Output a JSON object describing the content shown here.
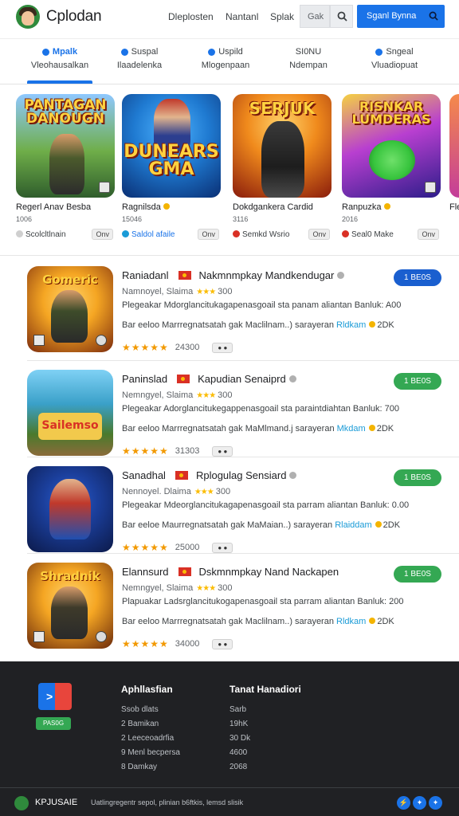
{
  "header": {
    "brand": "Cplodan",
    "nav": [
      "Dleplosten",
      "Nantanl",
      "Splak"
    ],
    "search_value": "Gak",
    "signin_label": "Sganl Bynna"
  },
  "tabs": [
    {
      "top": "Mpalk",
      "bottom": "Vleohausalkan",
      "active": true
    },
    {
      "top": "Suspal",
      "bottom": "Ilaadelenka",
      "active": false
    },
    {
      "top": "Uspild",
      "bottom": "Mlogenpaan",
      "active": false
    },
    {
      "top": "SI0NU",
      "bottom": "Ndempan",
      "active": false
    },
    {
      "top": "Sngeal",
      "bottom": "Vluadiopuat",
      "active": false
    }
  ],
  "featured": [
    {
      "art": "PANTAGAN DANOUGN",
      "name": "Regerl Anav Besba",
      "meta": "1006",
      "footer": "Scolcltlnain",
      "pill": "Onv",
      "colors": {
        "bg1": "#6fae49",
        "bg2": "#2f5d2c",
        "accent": "#c0392b"
      }
    },
    {
      "art": "DUNEARS GMA",
      "name": "Ragnilsda",
      "meta": "15046",
      "footer": "Saldol afaile",
      "pill": "Onv",
      "colors": {
        "bg1": "#1f7ad1",
        "bg2": "#0a2f74",
        "accent": "#e74c3c"
      }
    },
    {
      "art": "SERJUK",
      "name": "Dokdgankera Cardid",
      "meta": "3116",
      "footer": "Semkd Wsrio",
      "pill": "Onv",
      "colors": {
        "bg1": "#f08a1c",
        "bg2": "#8a1c0c",
        "accent": "#2d2d2d"
      }
    },
    {
      "art": "RISNKAR LUMDERAS",
      "name": "Ranpuzka",
      "meta": "2016",
      "footer": "Seal0 Make",
      "pill": "Onv",
      "colors": {
        "bg1": "#b83fd0",
        "bg2": "#2d1d8a",
        "accent": "#37c43d"
      }
    }
  ],
  "featured_partial": {
    "name": "Fle",
    "footer": ""
  },
  "list": [
    {
      "art": "Gomeric",
      "title_a": "Raniadanl",
      "title_b": "Nakmnmpkay Mandkendugar",
      "sub_a": "Namnoyel, Slaima",
      "sub_b": "300",
      "desc": "Plegeakar Mdorglancitukagapenasgoail sta panam aliantan Banluk: A00",
      "dev": "Bar eeloo Marrregnatsatah gak Maclilnam..) sarayeran",
      "dev_hl": "Rldkam",
      "dev_count": "2DK",
      "rating_text": "24300",
      "stars": "★★★★★",
      "install_label": "1 BE0S",
      "install_color": "#1a5fcf",
      "colors": {
        "bg1": "#f5a623",
        "bg2": "#7c2b0d"
      }
    },
    {
      "art": "Sailemso",
      "title_a": "Paninslad",
      "title_b": "Kapudian Senaiprd",
      "sub_a": "Nemngyel, Slaima",
      "sub_b": "300",
      "desc": "Plegeakar Adorglancitukegappenasgoail sta paraintdiahtan Banluk: 700",
      "dev": "Bar eeloo Marrregnatsatah gak MaMlmand.j sarayeran",
      "dev_hl": "Mkdam",
      "dev_count": "2DK",
      "rating_text": "31303",
      "stars": "★★★★★",
      "install_label": "1 BE0S",
      "install_color": "#34a853",
      "colors": {
        "bg1": "#3aa0c8",
        "bg2": "#4a7a2c"
      }
    },
    {
      "art": "",
      "title_a": "Sanadhal",
      "title_b": "Rplogulag Sensiard",
      "sub_a": "Nennoyel. Dlaima",
      "sub_b": "300",
      "desc": "Plegeakar Mdeorglancitukagapenasgoail sta parram aliantan Banluk: 0.00",
      "dev": "Bar eeloe Maurregnatsatah gak MaMaian..) sarayeran",
      "dev_hl": "Rlaiddam",
      "dev_count": "2DK",
      "rating_text": "25000",
      "stars": "★★★★★",
      "install_label": "1 BE0S",
      "install_color": "#34a853",
      "colors": {
        "bg1": "#0c1a4a",
        "bg2": "#1b3f9c"
      }
    },
    {
      "art": "Shradnik",
      "title_a": "Elannsurd",
      "title_b": "Dskmnmpkay Nand Nackapen",
      "sub_a": "Nemngyel, Slaima",
      "sub_b": "300",
      "desc": "Plapuakar Ladsrglancitukogapenasgoail sta parram aliantan Banluk: 200",
      "dev": "Bar eeloo Marrregnatsatah gak Maclilnam..) sarayeran",
      "dev_hl": "Rldkam",
      "dev_count": "2DK",
      "rating_text": "34000",
      "stars": "★★★★★",
      "install_label": "1 BE0S",
      "install_color": "#34a853",
      "colors": {
        "bg1": "#f5a623",
        "bg2": "#6b2a0b"
      }
    }
  ],
  "footer": {
    "badge": "PAS0G",
    "col1": {
      "head": "Aphllasfian",
      "items": [
        "Ssob dlats",
        "2  Bamikan",
        "2  Leeceoadrfia",
        "9  Menl becpersa",
        "8  Damkay"
      ]
    },
    "col2": {
      "head": "Tanat Hanadiori",
      "items": [
        "Sarb",
        "19hK",
        "30 Dk",
        "4600",
        "2068"
      ]
    },
    "bottom_name": "KPJUSAIE",
    "bottom_text": "Uatlingregentr sepol,  plinian  b6ftkis,   lemsd slisik",
    "social": [
      "⚡",
      "✦",
      "✦"
    ]
  }
}
